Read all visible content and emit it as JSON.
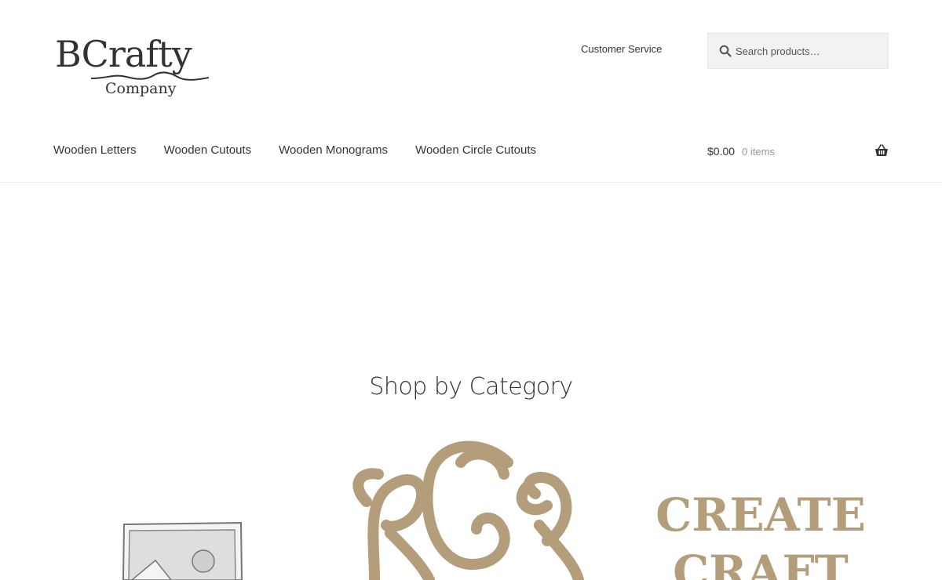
{
  "header": {
    "logo": {
      "name": "BCrafty",
      "company": "Company"
    },
    "customer_service": "Customer Service",
    "search": {
      "placeholder": "Search products…"
    }
  },
  "nav": {
    "items": [
      {
        "label": "Wooden Letters"
      },
      {
        "label": "Wooden Cutouts"
      },
      {
        "label": "Wooden Monograms"
      },
      {
        "label": "Wooden Circle Cutouts"
      }
    ]
  },
  "cart": {
    "amount": "$0.00",
    "count": "0 items",
    "icon": "basket-icon"
  },
  "main": {
    "section_title": "Shop by Category",
    "categories": [
      {
        "image": "placeholder-image-icon"
      },
      {
        "image": "wooden-monogram-image"
      },
      {
        "image": "create-craft-image",
        "image_text": [
          "CREATE",
          "CRAFT"
        ]
      }
    ]
  },
  "colors": {
    "wood": "#b39d7a",
    "text": "#333333",
    "search_bg": "#f2f2f2"
  }
}
